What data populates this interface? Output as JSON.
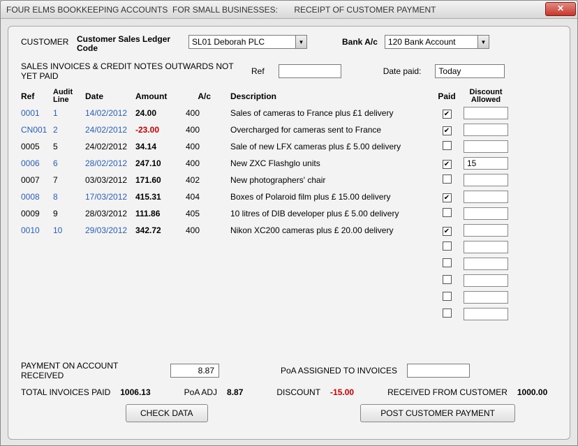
{
  "window": {
    "title": "FOUR ELMS BOOKKEEPING ACCOUNTS  FOR SMALL BUSINESSES:       RECEIPT OF CUSTOMER PAYMENT"
  },
  "labels": {
    "customer": "CUSTOMER",
    "ledger_code": "Customer Sales Ledger Code",
    "bank_ac": "Bank A/c",
    "not_paid": "SALES INVOICES & CREDIT NOTES OUTWARDS NOT YET PAID",
    "ref": "Ref",
    "date_paid": "Date paid:",
    "paid": "Paid",
    "discount_allowed": "Discount Allowed",
    "payment_on_account": "PAYMENT ON ACCOUNT RECEIVED",
    "poa_assigned": "PoA ASSIGNED TO INVOICES",
    "total_invoices_paid": "TOTAL INVOICES PAID",
    "poa_adj": "PoA ADJ",
    "discount": "DISCOUNT",
    "received": "RECEIVED FROM CUSTOMER",
    "check_data": "CHECK DATA",
    "post_payment": "POST CUSTOMER PAYMENT"
  },
  "combos": {
    "customer_value": "SL01  Deborah PLC",
    "bank_value": "120  Bank Account"
  },
  "fields": {
    "ref_value": "",
    "date_paid_value": "Today",
    "poa_received": "8.87",
    "poa_assigned_value": ""
  },
  "totals": {
    "total_invoices_paid": "1006.13",
    "poa_adj": "8.87",
    "discount": "-15.00",
    "received": "1000.00"
  },
  "grid": {
    "headers": {
      "ref": "Ref",
      "audit_line": "Audit Line",
      "date": "Date",
      "amount": "Amount",
      "ac": "A/c",
      "description": "Description"
    },
    "rows": [
      {
        "ref": "0001",
        "audit": "1",
        "date": "14/02/2012",
        "amount": "24.00",
        "ac": "400",
        "desc": "Sales of cameras to France plus £1 delivery",
        "paid": true,
        "discount": "",
        "blue": true,
        "neg": false
      },
      {
        "ref": "CN001",
        "audit": "2",
        "date": "24/02/2012",
        "amount": "-23.00",
        "ac": "400",
        "desc": "Overcharged for cameras sent to France",
        "paid": true,
        "discount": "",
        "blue": true,
        "neg": true
      },
      {
        "ref": "0005",
        "audit": "5",
        "date": "24/02/2012",
        "amount": "34.14",
        "ac": "400",
        "desc": "Sale of new LFX cameras plus £ 5.00 delivery",
        "paid": false,
        "discount": "",
        "blue": false,
        "neg": false
      },
      {
        "ref": "0006",
        "audit": "6",
        "date": "28/02/2012",
        "amount": "247.10",
        "ac": "400",
        "desc": "New ZXC Flashglo units",
        "paid": true,
        "discount": "15",
        "blue": true,
        "neg": false
      },
      {
        "ref": "0007",
        "audit": "7",
        "date": "03/03/2012",
        "amount": "171.60",
        "ac": "402",
        "desc": "New photographers' chair",
        "paid": false,
        "discount": "",
        "blue": false,
        "neg": false
      },
      {
        "ref": "0008",
        "audit": "8",
        "date": "17/03/2012",
        "amount": "415.31",
        "ac": "404",
        "desc": "Boxes of Polaroid film plus £ 15.00 delivery",
        "paid": true,
        "discount": "",
        "blue": true,
        "neg": false
      },
      {
        "ref": "0009",
        "audit": "9",
        "date": "28/03/2012",
        "amount": "111.86",
        "ac": "405",
        "desc": "10 litres of DIB developer plus £ 5.00 delivery",
        "paid": false,
        "discount": "",
        "blue": false,
        "neg": false
      },
      {
        "ref": "0010",
        "audit": "10",
        "date": "29/03/2012",
        "amount": "342.72",
        "ac": "400",
        "desc": "Nikon XC200 cameras plus £ 20.00 delivery",
        "paid": true,
        "discount": "",
        "blue": true,
        "neg": false
      }
    ],
    "blank_rows": 5
  }
}
